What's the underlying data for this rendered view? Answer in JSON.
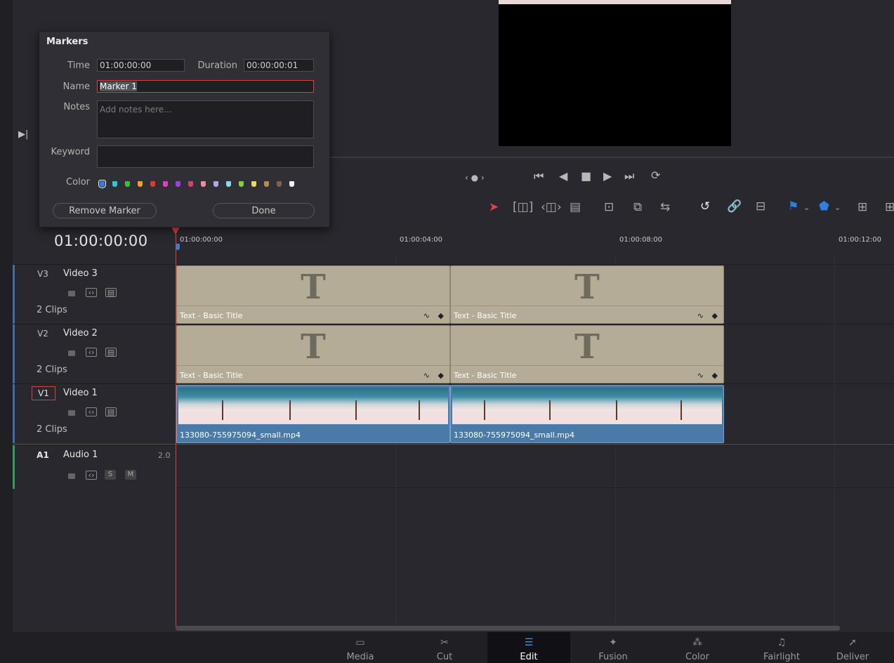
{
  "markers_dialog": {
    "title": "Markers",
    "time_label": "Time",
    "time_value": "01:00:00:00",
    "duration_label": "Duration",
    "duration_value": "00:00:00:01",
    "name_label": "Name",
    "name_value": "Marker 1",
    "notes_label": "Notes",
    "notes_placeholder": "Add notes here...",
    "keyword_label": "Keyword",
    "keyword_value": "",
    "color_label": "Color",
    "colors": [
      "#2f7fe0",
      "#2ec8d8",
      "#3bbf3b",
      "#f0a020",
      "#e03a2a",
      "#e040c0",
      "#9a40e0",
      "#d8406a",
      "#f08aa0",
      "#b0a8e8",
      "#8ad8f0",
      "#80d040",
      "#e8d860",
      "#b88a50",
      "#806050",
      "#f0f0f0"
    ],
    "remove_button": "Remove Marker",
    "done_button": "Done"
  },
  "timeline": {
    "timecode": "01:00:00:00",
    "ruler_labels": [
      "01:00:00:00",
      "01:00:04:00",
      "01:00:08:00",
      "01:00:12:00"
    ]
  },
  "tracks": [
    {
      "id": "V3",
      "name": "Video 3",
      "clips": "2 Clips"
    },
    {
      "id": "V2",
      "name": "Video 2",
      "clips": "2 Clips"
    },
    {
      "id": "V1",
      "name": "Video 1",
      "clips": "2 Clips"
    },
    {
      "id": "A1",
      "name": "Audio 1",
      "channels": "2.0",
      "solo": "S",
      "mute": "M"
    }
  ],
  "clips": {
    "title_clip_letter": "T",
    "title_clip_label": "Text - Basic Title",
    "video_clip_label": "133080-755975094_small.mp4"
  },
  "page_nav": [
    {
      "label": "Media",
      "icon": "media-icon"
    },
    {
      "label": "Cut",
      "icon": "cut-icon"
    },
    {
      "label": "Edit",
      "icon": "edit-icon",
      "active": true
    },
    {
      "label": "Fusion",
      "icon": "fusion-icon"
    },
    {
      "label": "Color",
      "icon": "color-icon"
    },
    {
      "label": "Fairlight",
      "icon": "fairlight-icon"
    },
    {
      "label": "Deliver",
      "icon": "deliver-icon"
    }
  ],
  "colors": {
    "playhead": "#d0463e",
    "active_accent": "#4a8fe0",
    "title_clip": "#b5ac97",
    "video_clip": "#4a7ba8"
  }
}
